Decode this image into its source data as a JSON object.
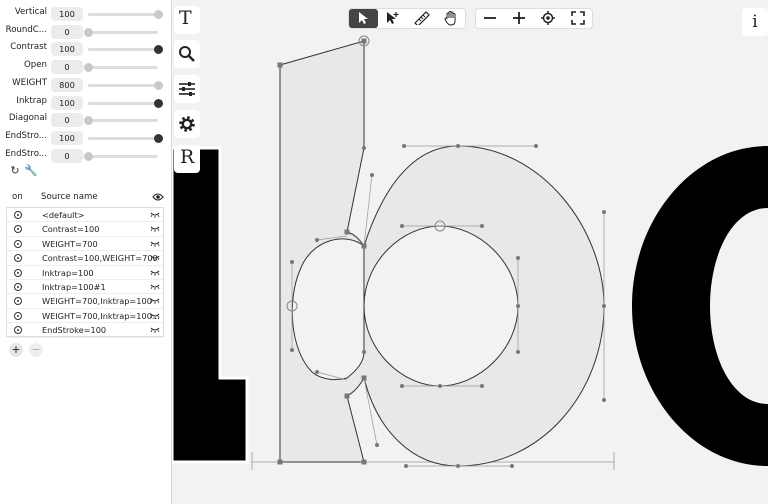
{
  "axes": [
    {
      "label": "Vertical",
      "value": "100",
      "fraction": 1.0,
      "dark": false
    },
    {
      "label": "RoundC...",
      "value": "0",
      "fraction": 0.0,
      "dark": false
    },
    {
      "label": "Contrast",
      "value": "100",
      "fraction": 1.0,
      "dark": true
    },
    {
      "label": "Open",
      "value": "0",
      "fraction": 0.0,
      "dark": false
    },
    {
      "label": "WEIGHT",
      "value": "800",
      "fraction": 1.0,
      "dark": false
    },
    {
      "label": "Inktrap",
      "value": "100",
      "fraction": 1.0,
      "dark": true
    },
    {
      "label": "Diagonal",
      "value": "0",
      "fraction": 0.0,
      "dark": false
    },
    {
      "label": "EndStro...",
      "value": "100",
      "fraction": 1.0,
      "dark": true
    },
    {
      "label": "EndStro...",
      "value": "0",
      "fraction": 0.0,
      "dark": false
    }
  ],
  "sources_header": {
    "on": "on",
    "name": "Source name"
  },
  "sources": [
    "<default>",
    "Contrast=100",
    "WEIGHT=700",
    "Contrast=100,WEIGHT=700",
    "Inktrap=100",
    "Inktrap=100#1",
    "WEIGHT=700,Inktrap=100",
    "WEIGHT=700,Inktrap=100...",
    "EndStroke=100"
  ],
  "buttons": {
    "add": "+",
    "remove": "−"
  },
  "tools": {
    "text": "T",
    "info": "i",
    "sources_letter": "R"
  },
  "colors": {
    "glyph_fill": "#e8e8e8",
    "glyph_stroke": "#333333",
    "active_tool": "#444444",
    "panel_bg": "#ffffff"
  }
}
